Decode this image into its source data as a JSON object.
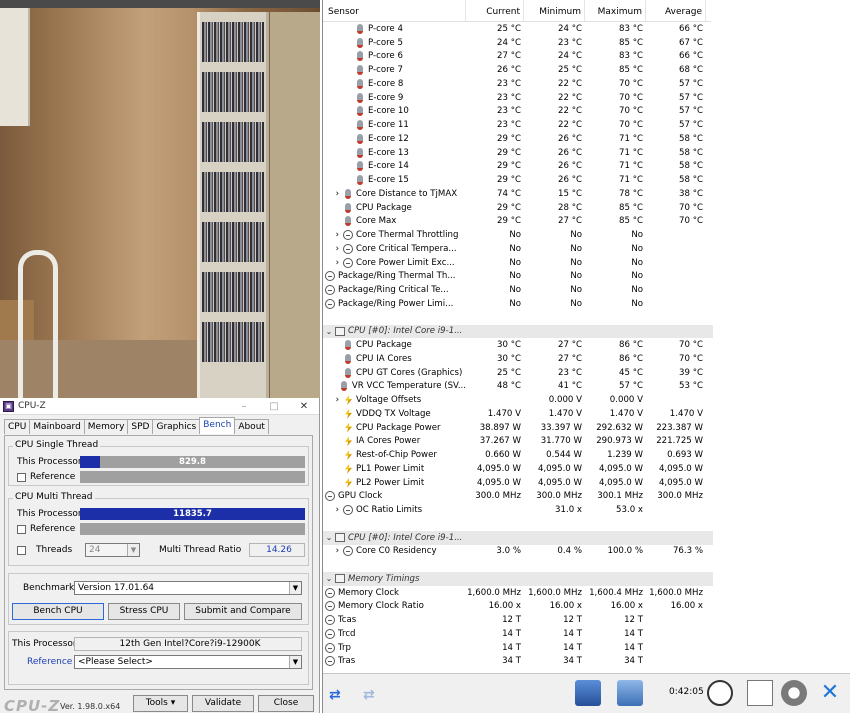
{
  "cpuz": {
    "title": "CPU-Z",
    "tabs": [
      "CPU",
      "Mainboard",
      "Memory",
      "SPD",
      "Graphics",
      "Bench",
      "About"
    ],
    "active_tab": "Bench",
    "single_thread": {
      "group_label": "CPU Single Thread",
      "this_processor_label": "This Processor",
      "this_processor_value": "829.8",
      "this_processor_fraction": 0.09,
      "reference_label": "Reference"
    },
    "multi_thread": {
      "group_label": "CPU Multi Thread",
      "this_processor_label": "This Processor",
      "this_processor_value": "11835.7",
      "this_processor_fraction": 1.0,
      "reference_label": "Reference",
      "threads_label": "Threads",
      "threads_value": "24",
      "ratio_label": "Multi Thread Ratio",
      "ratio_value": "14.26"
    },
    "benchmark_label": "Benchmark",
    "benchmark_value": "Version 17.01.64",
    "bench_cpu_button": "Bench CPU",
    "stress_cpu_button": "Stress CPU",
    "submit_button": "Submit and Compare",
    "processor_label": "This Processor",
    "processor_value": "12th Gen Intel?Core?i9-12900K",
    "reference_label": "Reference",
    "reference_value": "<Please Select>",
    "logo": "CPU-Z",
    "version": "Ver. 1.98.0.x64",
    "tools_button": "Tools",
    "validate_button": "Validate",
    "close_button": "Close"
  },
  "hwinfo": {
    "columns": [
      "Sensor",
      "Current",
      "Minimum",
      "Maximum",
      "Average"
    ],
    "rows": [
      {
        "type": "sensor",
        "indent": 2,
        "icon": "thermometer-icon",
        "name": "P-core 4",
        "cur": "25 °C",
        "min": "24 °C",
        "max": "83 °C",
        "avg": "66 °C"
      },
      {
        "type": "sensor",
        "indent": 2,
        "icon": "thermometer-icon",
        "name": "P-core 5",
        "cur": "24 °C",
        "min": "23 °C",
        "max": "85 °C",
        "avg": "67 °C"
      },
      {
        "type": "sensor",
        "indent": 2,
        "icon": "thermometer-icon",
        "name": "P-core 6",
        "cur": "27 °C",
        "min": "24 °C",
        "max": "83 °C",
        "avg": "66 °C"
      },
      {
        "type": "sensor",
        "indent": 2,
        "icon": "thermometer-icon",
        "name": "P-core 7",
        "cur": "26 °C",
        "min": "25 °C",
        "max": "85 °C",
        "avg": "68 °C"
      },
      {
        "type": "sensor",
        "indent": 2,
        "icon": "thermometer-icon",
        "name": "E-core 8",
        "cur": "23 °C",
        "min": "22 °C",
        "max": "70 °C",
        "avg": "57 °C"
      },
      {
        "type": "sensor",
        "indent": 2,
        "icon": "thermometer-icon",
        "name": "E-core 9",
        "cur": "23 °C",
        "min": "22 °C",
        "max": "70 °C",
        "avg": "57 °C"
      },
      {
        "type": "sensor",
        "indent": 2,
        "icon": "thermometer-icon",
        "name": "E-core 10",
        "cur": "23 °C",
        "min": "22 °C",
        "max": "70 °C",
        "avg": "57 °C"
      },
      {
        "type": "sensor",
        "indent": 2,
        "icon": "thermometer-icon",
        "name": "E-core 11",
        "cur": "23 °C",
        "min": "22 °C",
        "max": "70 °C",
        "avg": "57 °C"
      },
      {
        "type": "sensor",
        "indent": 2,
        "icon": "thermometer-icon",
        "name": "E-core 12",
        "cur": "29 °C",
        "min": "26 °C",
        "max": "71 °C",
        "avg": "58 °C"
      },
      {
        "type": "sensor",
        "indent": 2,
        "icon": "thermometer-icon",
        "name": "E-core 13",
        "cur": "29 °C",
        "min": "26 °C",
        "max": "71 °C",
        "avg": "58 °C"
      },
      {
        "type": "sensor",
        "indent": 2,
        "icon": "thermometer-icon",
        "name": "E-core 14",
        "cur": "29 °C",
        "min": "26 °C",
        "max": "71 °C",
        "avg": "58 °C"
      },
      {
        "type": "sensor",
        "indent": 2,
        "icon": "thermometer-icon",
        "name": "E-core 15",
        "cur": "29 °C",
        "min": "26 °C",
        "max": "71 °C",
        "avg": "58 °C"
      },
      {
        "type": "sensor",
        "indent": 1,
        "caret": "›",
        "icon": "thermometer-icon",
        "name": "Core Distance to TjMAX",
        "cur": "74 °C",
        "min": "15 °C",
        "max": "78 °C",
        "avg": "38 °C"
      },
      {
        "type": "sensor",
        "indent": 1,
        "icon": "thermometer-icon",
        "name": "CPU Package",
        "cur": "29 °C",
        "min": "28 °C",
        "max": "85 °C",
        "avg": "70 °C"
      },
      {
        "type": "sensor",
        "indent": 1,
        "icon": "thermometer-icon",
        "name": "Core Max",
        "cur": "29 °C",
        "min": "27 °C",
        "max": "85 °C",
        "avg": "70 °C"
      },
      {
        "type": "sensor",
        "indent": 1,
        "caret": "›",
        "icon": "status-circle-icon",
        "name": "Core Thermal Throttling",
        "cur": "No",
        "min": "No",
        "max": "No",
        "avg": ""
      },
      {
        "type": "sensor",
        "indent": 1,
        "caret": "›",
        "icon": "status-circle-icon",
        "name": "Core Critical Tempera...",
        "cur": "No",
        "min": "No",
        "max": "No",
        "avg": ""
      },
      {
        "type": "sensor",
        "indent": 1,
        "caret": "›",
        "icon": "status-circle-icon",
        "name": "Core Power Limit Exc...",
        "cur": "No",
        "min": "No",
        "max": "No",
        "avg": ""
      },
      {
        "type": "sensor",
        "indent": 0,
        "icon": "status-circle-icon",
        "name": "Package/Ring Thermal Th...",
        "cur": "No",
        "min": "No",
        "max": "No",
        "avg": ""
      },
      {
        "type": "sensor",
        "indent": 0,
        "icon": "status-circle-icon",
        "name": "Package/Ring Critical Te...",
        "cur": "No",
        "min": "No",
        "max": "No",
        "avg": ""
      },
      {
        "type": "sensor",
        "indent": 0,
        "icon": "status-circle-icon",
        "name": "Package/Ring Power Limi...",
        "cur": "No",
        "min": "No",
        "max": "No",
        "avg": ""
      },
      {
        "type": "blank"
      },
      {
        "type": "group",
        "name": "CPU [#0]: Intel Core i9-1..."
      },
      {
        "type": "sensor",
        "indent": 1,
        "icon": "thermometer-icon",
        "name": "CPU Package",
        "cur": "30 °C",
        "min": "27 °C",
        "max": "86 °C",
        "avg": "70 °C"
      },
      {
        "type": "sensor",
        "indent": 1,
        "icon": "thermometer-icon",
        "name": "CPU IA Cores",
        "cur": "30 °C",
        "min": "27 °C",
        "max": "86 °C",
        "avg": "70 °C"
      },
      {
        "type": "sensor",
        "indent": 1,
        "icon": "thermometer-icon",
        "name": "CPU GT Cores (Graphics)",
        "cur": "25 °C",
        "min": "23 °C",
        "max": "45 °C",
        "avg": "39 °C"
      },
      {
        "type": "sensor",
        "indent": 1,
        "icon": "thermometer-icon",
        "name": "VR VCC Temperature (SV...",
        "cur": "48 °C",
        "min": "41 °C",
        "max": "57 °C",
        "avg": "53 °C"
      },
      {
        "type": "sensor",
        "indent": 1,
        "caret": "›",
        "icon": "lightning-icon",
        "name": "Voltage Offsets",
        "cur": "",
        "min": "0.000 V",
        "max": "0.000 V",
        "avg": ""
      },
      {
        "type": "sensor",
        "indent": 1,
        "icon": "lightning-icon",
        "name": "VDDQ TX Voltage",
        "cur": "1.470 V",
        "min": "1.470 V",
        "max": "1.470 V",
        "avg": "1.470 V"
      },
      {
        "type": "sensor",
        "indent": 1,
        "icon": "lightning-icon",
        "name": "CPU Package Power",
        "cur": "38.897 W",
        "min": "33.397 W",
        "max": "292.632 W",
        "avg": "223.387 W"
      },
      {
        "type": "sensor",
        "indent": 1,
        "icon": "lightning-icon",
        "name": "IA Cores Power",
        "cur": "37.267 W",
        "min": "31.770 W",
        "max": "290.973 W",
        "avg": "221.725 W"
      },
      {
        "type": "sensor",
        "indent": 1,
        "icon": "lightning-icon",
        "name": "Rest-of-Chip Power",
        "cur": "0.660 W",
        "min": "0.544 W",
        "max": "1.239 W",
        "avg": "0.693 W"
      },
      {
        "type": "sensor",
        "indent": 1,
        "icon": "lightning-icon",
        "name": "PL1 Power Limit",
        "cur": "4,095.0 W",
        "min": "4,095.0 W",
        "max": "4,095.0 W",
        "avg": "4,095.0 W"
      },
      {
        "type": "sensor",
        "indent": 1,
        "icon": "lightning-icon",
        "name": "PL2 Power Limit",
        "cur": "4,095.0 W",
        "min": "4,095.0 W",
        "max": "4,095.0 W",
        "avg": "4,095.0 W"
      },
      {
        "type": "sensor",
        "indent": 0,
        "icon": "status-circle-icon",
        "name": "GPU Clock",
        "cur": "300.0 MHz",
        "min": "300.0 MHz",
        "max": "300.1 MHz",
        "avg": "300.0 MHz"
      },
      {
        "type": "sensor",
        "indent": 1,
        "caret": "›",
        "icon": "status-circle-icon",
        "name": "OC Ratio Limits",
        "cur": "",
        "min": "31.0 x",
        "max": "53.0 x",
        "avg": ""
      },
      {
        "type": "blank"
      },
      {
        "type": "group",
        "name": "CPU [#0]: Intel Core i9-1..."
      },
      {
        "type": "sensor",
        "indent": 1,
        "caret": "›",
        "icon": "status-circle-icon",
        "name": "Core C0 Residency",
        "cur": "3.0 %",
        "min": "0.4 %",
        "max": "100.0 %",
        "avg": "76.3 %"
      },
      {
        "type": "blank"
      },
      {
        "type": "group",
        "name": "Memory Timings"
      },
      {
        "type": "sensor",
        "indent": 0,
        "icon": "status-circle-icon",
        "name": "Memory Clock",
        "cur": "1,600.0 MHz",
        "min": "1,600.0 MHz",
        "max": "1,600.4 MHz",
        "avg": "1,600.0 MHz"
      },
      {
        "type": "sensor",
        "indent": 0,
        "icon": "status-circle-icon",
        "name": "Memory Clock Ratio",
        "cur": "16.00 x",
        "min": "16.00 x",
        "max": "16.00 x",
        "avg": "16.00 x"
      },
      {
        "type": "sensor",
        "indent": 0,
        "icon": "status-circle-icon",
        "name": "Tcas",
        "cur": "12 T",
        "min": "12 T",
        "max": "12 T",
        "avg": ""
      },
      {
        "type": "sensor",
        "indent": 0,
        "icon": "status-circle-icon",
        "name": "Trcd",
        "cur": "14 T",
        "min": "14 T",
        "max": "14 T",
        "avg": ""
      },
      {
        "type": "sensor",
        "indent": 0,
        "icon": "status-circle-icon",
        "name": "Trp",
        "cur": "14 T",
        "min": "14 T",
        "max": "14 T",
        "avg": ""
      },
      {
        "type": "sensor",
        "indent": 0,
        "icon": "status-circle-icon",
        "name": "Tras",
        "cur": "34 T",
        "min": "34 T",
        "max": "34 T",
        "avg": ""
      }
    ],
    "timer": "0:42:05",
    "colors": {
      "bar_fill": "#1c2fa8",
      "bar_track": "#a0a0a0",
      "group_row_bg": "#e8e8e8"
    }
  }
}
